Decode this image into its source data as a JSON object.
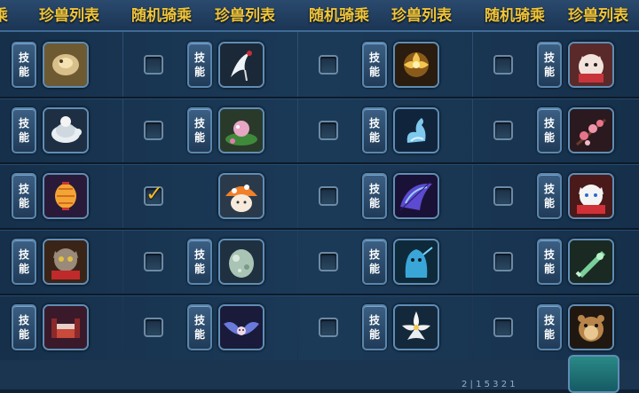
{
  "header": {
    "labels": [
      "乘",
      "珍兽列表",
      "随机骑乘",
      "珍兽列表",
      "随机骑乘",
      "珍兽列表",
      "随机骑乘",
      "珍兽列表"
    ]
  },
  "skill_label": {
    "top": "技",
    "bottom": "能"
  },
  "rows": [
    {
      "cells": [
        {
          "pet": "golden-scroll-pet",
          "skill": true
        },
        {
          "pet": "white-crane-pet",
          "skill": true,
          "checked": false
        },
        {
          "pet": "golden-flower-pet",
          "skill": true,
          "checked": false
        },
        {
          "pet": "lucky-cat-pet",
          "skill": true,
          "checked": false
        }
      ]
    },
    {
      "cells": [
        {
          "pet": "white-turtle-pet",
          "skill": true
        },
        {
          "pet": "lotus-frog-pet",
          "skill": true,
          "checked": false
        },
        {
          "pet": "crystal-swan-pet",
          "skill": true,
          "checked": false
        },
        {
          "pet": "plum-blossom-pet",
          "skill": true,
          "checked": false
        }
      ]
    },
    {
      "cells": [
        {
          "pet": "lantern-pet",
          "skill": true
        },
        {
          "pet": "mushroom-pet",
          "skill": false,
          "checked": true
        },
        {
          "pet": "butterfly-wing-pet",
          "skill": true,
          "checked": false
        },
        {
          "pet": "red-cat-pet",
          "skill": true,
          "checked": false
        }
      ]
    },
    {
      "cells": [
        {
          "pet": "grumpy-cat-pet",
          "skill": true
        },
        {
          "pet": "stone-egg-pet",
          "skill": true,
          "checked": false
        },
        {
          "pet": "blue-ghost-pet",
          "skill": true,
          "checked": false
        },
        {
          "pet": "jade-sword-pet",
          "skill": true,
          "checked": false
        }
      ]
    },
    {
      "cells": [
        {
          "pet": "red-bed-pet",
          "skill": true
        },
        {
          "pet": "bat-fairy-pet",
          "skill": true,
          "checked": false
        },
        {
          "pet": "white-lily-pet",
          "skill": true,
          "checked": false
        },
        {
          "pet": "hamster-pet",
          "skill": true,
          "checked": false
        }
      ]
    }
  ],
  "footer": {
    "text": "2 | 1 5  3 2 1"
  }
}
